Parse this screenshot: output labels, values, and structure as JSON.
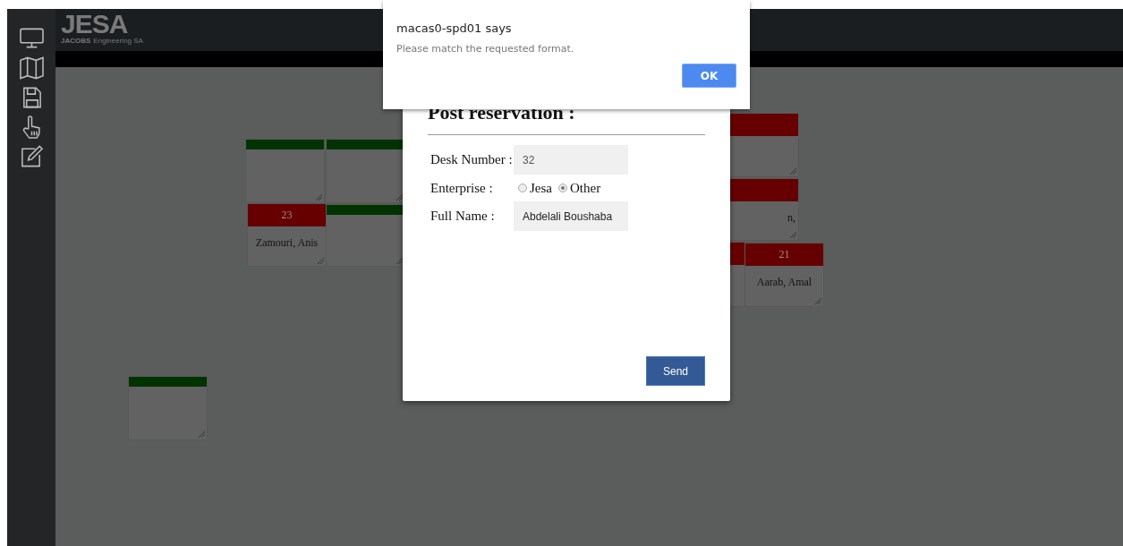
{
  "header": {
    "logo": "JESA",
    "company": "JACOBS",
    "subtitle": "Engineering SA"
  },
  "desks": [
    {
      "occupied": false,
      "color": "#003300"
    },
    {
      "occupied": false,
      "color": "#003300"
    },
    {
      "occupied": true,
      "color": "#660000",
      "number": "23",
      "name": "Zamouri, Anis"
    },
    {
      "occupied": false,
      "color": "#003300"
    },
    {
      "occupied": true,
      "color": "#660000"
    },
    {
      "occupied": true,
      "color": "#660000",
      "name": "n,"
    },
    {
      "occupied": true,
      "color": "#660000"
    },
    {
      "occupied": true,
      "color": "#660000",
      "number": "21",
      "name": "Aarab, Amal"
    },
    {
      "occupied": false,
      "color": "#003300"
    }
  ],
  "modal": {
    "title": "Post reservation :",
    "desk_number": {
      "label": "Desk Number :",
      "value": "32"
    },
    "enterprise": {
      "label": "Enterprise :",
      "options": [
        {
          "label": "Jesa",
          "selected": false
        },
        {
          "label": "Other",
          "selected": true
        }
      ]
    },
    "full_name": {
      "label": "Full Name :",
      "value": "Abdelali Boushaba"
    },
    "button": "Send"
  },
  "alert": {
    "title": "macas0-spd01 says",
    "message": "Please match the requested format.",
    "button": "OK"
  }
}
